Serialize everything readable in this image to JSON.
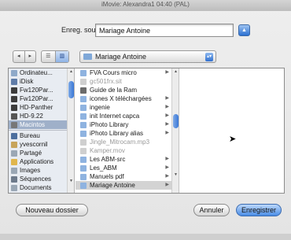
{
  "window": {
    "title": "iMovie: Alexandra1  04:40 (PAL)"
  },
  "save": {
    "label": "Enreg. sous :",
    "value": "Mariage Antoine",
    "disclosure_icon": "disclosure-up-icon"
  },
  "toolbar": {
    "back_icon": "◂",
    "forward_icon": "▸",
    "list_view_icon": "☰",
    "column_view_icon": "▥",
    "location": "Mariage Antoine"
  },
  "sidebar": {
    "items": [
      {
        "label": "Ordinateu...",
        "icon": "computer-icon",
        "color": "#8ea9c9"
      },
      {
        "label": "iDisk",
        "icon": "idisk-icon",
        "color": "#5f7ca8"
      },
      {
        "label": "Fw120Par...",
        "icon": "drive-icon",
        "color": "#3c3c3c"
      },
      {
        "label": "Fw120Par...",
        "icon": "drive-icon",
        "color": "#3c3c3c"
      },
      {
        "label": "HD-Panther",
        "icon": "drive-icon",
        "color": "#3c3c3c"
      },
      {
        "label": "HD-9.22",
        "icon": "drive-icon",
        "color": "#555555"
      },
      {
        "label": "Macintos",
        "icon": "drive-icon",
        "color": "#777777",
        "selected": true
      },
      {
        "label": "Bureau",
        "icon": "desktop-icon",
        "color": "#4d6f9e"
      },
      {
        "label": "yvescornil",
        "icon": "home-icon",
        "color": "#c7a45a"
      },
      {
        "label": "Partagé",
        "icon": "shared-folder-icon",
        "color": "#9aa7b5"
      },
      {
        "label": "Applications",
        "icon": "applications-icon",
        "color": "#e0b64d"
      },
      {
        "label": "Images",
        "icon": "pictures-folder-icon",
        "color": "#9aa7b5"
      },
      {
        "label": "Séquences",
        "icon": "movies-folder-icon",
        "color": "#6d7a8b"
      },
      {
        "label": "Documents",
        "icon": "documents-folder-icon",
        "color": "#9aa7b5"
      },
      {
        "label": "Musique",
        "icon": "music-folder-icon",
        "color": "#9aa7b5"
      }
    ]
  },
  "files": {
    "items": [
      {
        "label": "FVA Cours micro",
        "icon": "folder-icon",
        "folder": true
      },
      {
        "label": "gc501frx.sit",
        "icon": "archive-icon",
        "dim": true
      },
      {
        "label": "Guide de la Ram",
        "icon": "document-icon"
      },
      {
        "label": "icones X téléchargées",
        "icon": "folder-icon",
        "folder": true
      },
      {
        "label": "ingenie",
        "icon": "folder-icon",
        "folder": true
      },
      {
        "label": "init Internet capca",
        "icon": "folder-icon",
        "folder": true
      },
      {
        "label": "iPhoto Library",
        "icon": "folder-icon",
        "folder": true
      },
      {
        "label": "iPhoto Library alias",
        "icon": "alias-icon",
        "folder": true
      },
      {
        "label": "Jingle_Mitrocam.mp3",
        "icon": "audio-file-icon",
        "dim": true
      },
      {
        "label": "Kamper.mov",
        "icon": "movie-file-icon",
        "dim": true
      },
      {
        "label": "Les ABM-src",
        "icon": "folder-icon",
        "folder": true
      },
      {
        "label": "Les_ABM",
        "icon": "folder-icon",
        "folder": true
      },
      {
        "label": "Manuels pdf",
        "icon": "folder-icon",
        "folder": true
      },
      {
        "label": "Mariage Antoine",
        "icon": "folder-icon",
        "folder": true,
        "selected": true
      }
    ]
  },
  "buttons": {
    "new_folder": "Nouveau dossier",
    "cancel": "Annuler",
    "save": "Enregistrer"
  },
  "colors": {
    "accent": "#4a8de6",
    "sidebar_bg": "#e8ecf2",
    "folder": "#8fb3e0"
  }
}
